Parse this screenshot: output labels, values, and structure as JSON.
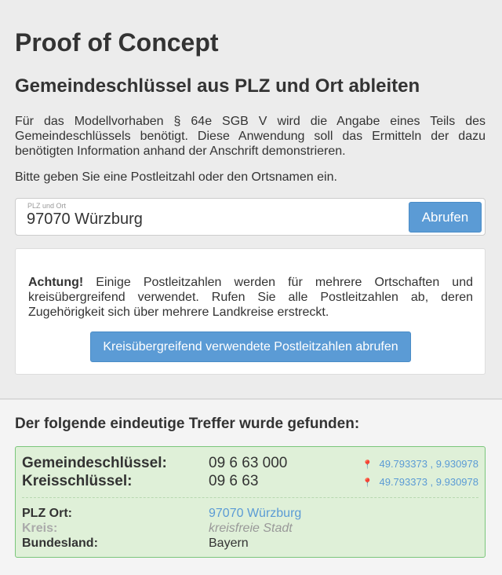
{
  "page": {
    "title": "Proof of Concept",
    "subtitle": "Gemeindeschlüssel aus PLZ und Ort ableiten",
    "intro": "Für das Modellvorhaben § 64e SGB V wird die Angabe eines Teils des Gemeindeschlüssels benötigt. Diese Anwendung soll das Ermitteln der dazu benötigten Information anhand der Anschrift demonstrieren.",
    "hint": "Bitte geben Sie eine Postleitzahl oder den Ortsnamen ein."
  },
  "search": {
    "label": "PLZ und Ort",
    "value": "97070 Würzburg",
    "button": "Abrufen"
  },
  "alert": {
    "strong": "Achtung!",
    "text": " Einige Postleitzahlen werden für mehrere Ortschaften und kreisübergreifend verwendet. Rufen Sie alle Postleitzahlen ab, deren Zugehörigkeit sich über mehrere Landkreise erstreckt.",
    "button": "Kreisübergreifend verwendete Postleitzahlen abrufen"
  },
  "result": {
    "heading": "Der folgende eindeutige Treffer wurde gefunden:",
    "gemeinde_label": "Gemeindeschlüssel:",
    "gemeinde_value": "09 6 63 000",
    "gemeinde_coords": "49.793373 , 9.930978",
    "kreis_key_label": "Kreisschlüssel:",
    "kreis_key_value": "09 6 63",
    "kreis_key_coords": "49.793373 , 9.930978",
    "plz_label": "PLZ Ort:",
    "plz_value": "97070 Würzburg",
    "kreis_label": "Kreis:",
    "kreis_value": "kreisfreie Stadt",
    "land_label": "Bundesland:",
    "land_value": "Bayern"
  },
  "colors": {
    "primary": "#5b9bd5",
    "success_bg": "#dff0d8",
    "success_border": "#7bc67b",
    "pin": "#d9534f"
  },
  "icons": {
    "pin": "map-pin-icon"
  }
}
